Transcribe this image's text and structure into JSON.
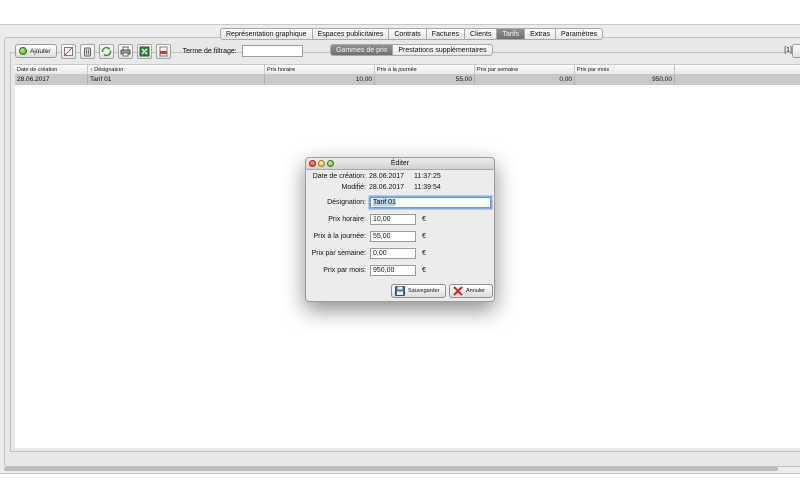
{
  "main_tabs": [
    "Représentation graphique",
    "Espaces publicitaires",
    "Contrats",
    "Factures",
    "Clients",
    "Tarifs",
    "Extras",
    "Paramètres"
  ],
  "main_tab_active": "Tarifs",
  "sub_tabs": [
    "Gammes de prix",
    "Prestations supplémentaires"
  ],
  "sub_tab_active": "Gammes de prix",
  "toolbar": {
    "add_label": "Ajouter",
    "icons": [
      "delete-icon",
      "trash-icon",
      "refresh-icon",
      "print-icon",
      "export-excel-icon",
      "export-pdf-icon"
    ],
    "filter_label": "Terme de filtrage:",
    "filter_value": ""
  },
  "page_indicator": "[1]",
  "table": {
    "columns": [
      "Date de création",
      "↑ Désignation",
      "Prix horaire",
      "Prix à la journée",
      "Prix par semaine",
      "Prix par mois"
    ],
    "rows": [
      [
        "28.06.2017",
        "Tarif 01",
        "10,00",
        "55,00",
        "0,00",
        "950,00"
      ]
    ]
  },
  "dialog": {
    "title": "Éditer",
    "created_label": "Date de création:",
    "created_date": "28.06.2017",
    "created_time": "11:37:25",
    "modified_label": "Modifié:",
    "modified_date": "28.06.2017",
    "modified_time": "11:39:54",
    "designation_label": "Désignation:",
    "designation_value": "Tarif 01",
    "hourly_label": "Prix horaire:",
    "hourly_value": "10,00",
    "daily_label": "Prix à la journée:",
    "daily_value": "55,00",
    "weekly_label": "Prix par semaine:",
    "weekly_value": "0,00",
    "monthly_label": "Prix par mois:",
    "monthly_value": "950,00",
    "currency": "€",
    "save_label": "Sauvegarder",
    "cancel_label": "Annuler"
  },
  "colors": {
    "active_tab": "#7a7a7a",
    "selected_row": "#c9c9c9",
    "dialog_bg": "#ececec"
  }
}
